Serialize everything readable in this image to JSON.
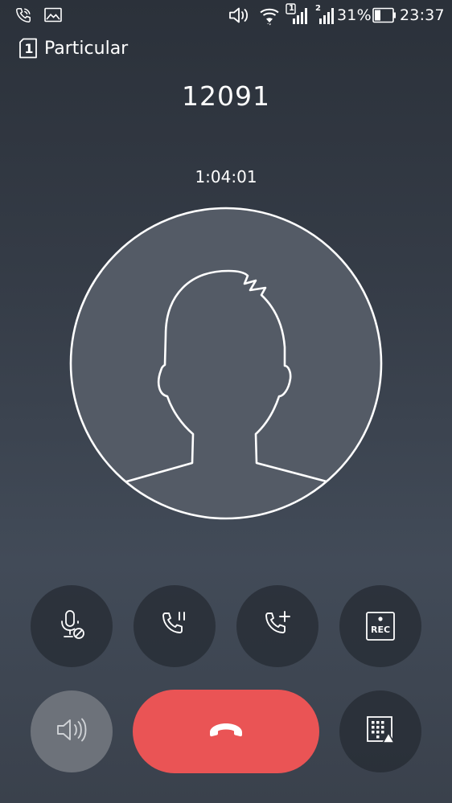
{
  "status_bar": {
    "icons": [
      "phone-call-icon",
      "gallery-icon",
      "volume-icon",
      "wifi-icon",
      "signal-sim1-icon",
      "signal-sim2-icon",
      "battery-icon"
    ],
    "sim1_badge": "1",
    "sim2_badge": "2",
    "battery_percent": "31%",
    "battery_level": 0.31,
    "time": "23:37"
  },
  "call": {
    "sim_badge": "1",
    "sim_label": "Particular",
    "number": "12091",
    "duration": "1:04:01"
  },
  "controls": {
    "row1": [
      "mute-mic-icon",
      "hold-call-icon",
      "add-call-icon",
      "record-icon"
    ],
    "record_label": "REC",
    "row2": [
      "speaker-icon",
      "end-call-icon",
      "dialpad-icon"
    ]
  },
  "colors": {
    "end_call": "#ea5455",
    "speaker_active": "#6d727a",
    "control_bg": "#262b33"
  }
}
